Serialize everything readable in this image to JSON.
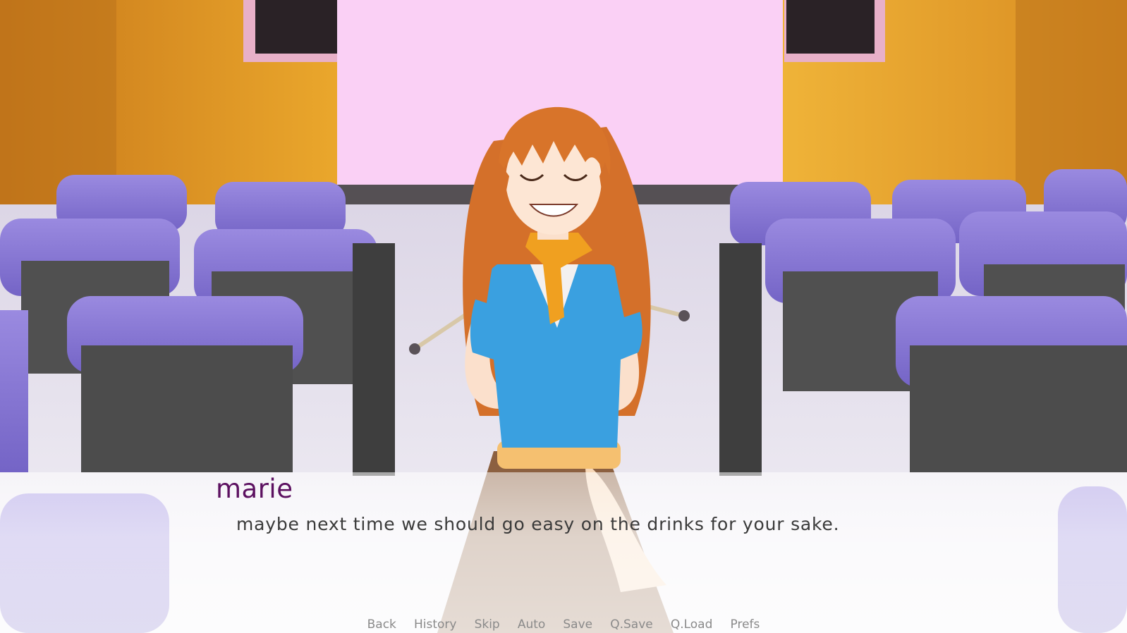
{
  "dialogue": {
    "speaker": "marie",
    "text": "maybe next time we should go easy on the drinks for your sake.",
    "speaker_color": "#5c1060"
  },
  "quick_menu": [
    {
      "label": "Back"
    },
    {
      "label": "History"
    },
    {
      "label": "Skip"
    },
    {
      "label": "Auto"
    },
    {
      "label": "Save"
    },
    {
      "label": "Q.Save"
    },
    {
      "label": "Q.Load"
    },
    {
      "label": "Prefs"
    }
  ],
  "scene": {
    "background": "lecture-hall-with-projection-screen",
    "character": "marie-smiling-sprite"
  }
}
